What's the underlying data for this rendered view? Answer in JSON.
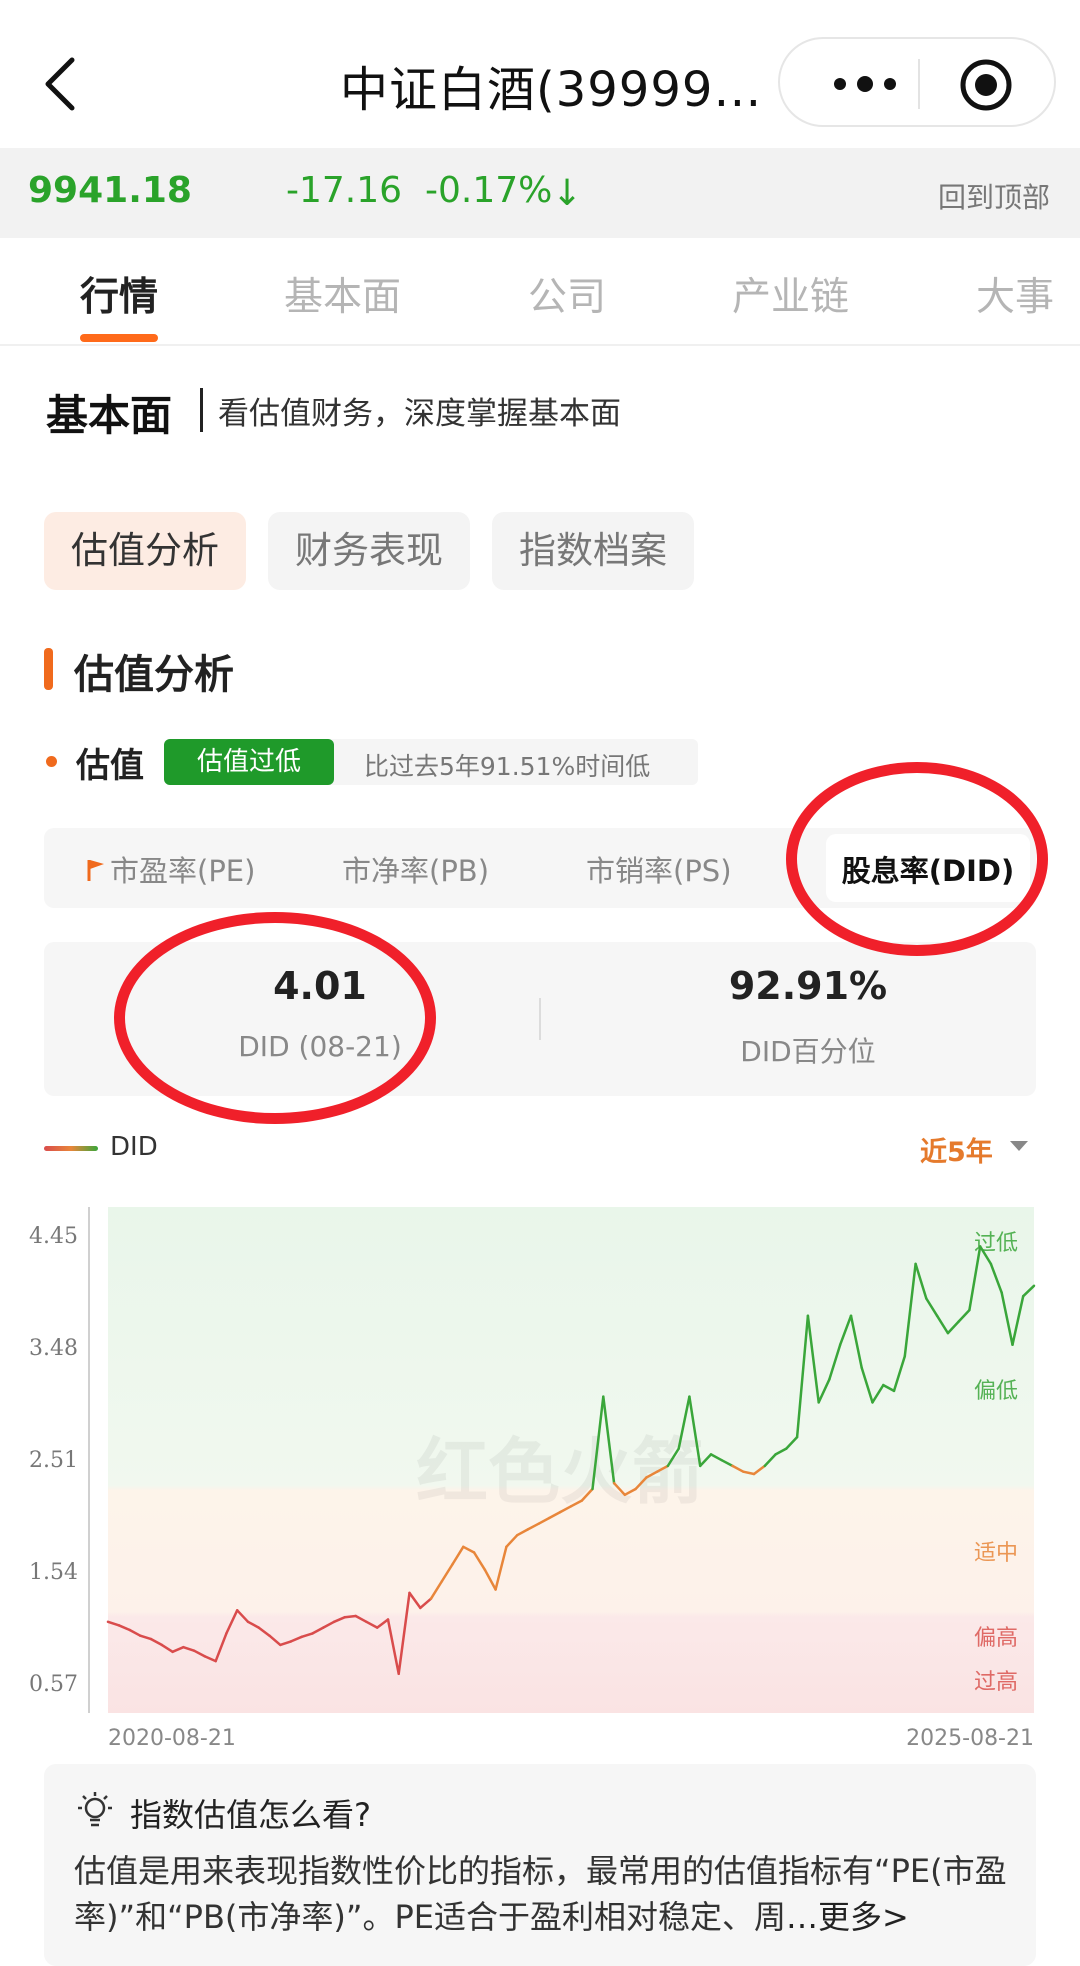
{
  "header": {
    "title": "中证白酒(39999…"
  },
  "quote": {
    "price": "9941.18",
    "change": "-17.16",
    "change_pct": "-0.17%",
    "arrow": "↓",
    "back_to_top": "回到顶部"
  },
  "tabs": [
    {
      "label": "行情",
      "active": true
    },
    {
      "label": "基本面",
      "active": false
    },
    {
      "label": "公司",
      "active": false
    },
    {
      "label": "产业链",
      "active": false
    },
    {
      "label": "大事",
      "active": false
    }
  ],
  "section": {
    "title": "基本面",
    "subtitle": "看估值财务，深度掌握基本面"
  },
  "chips": [
    "估值分析",
    "财务表现",
    "指数档案"
  ],
  "analysis": {
    "title": "估值分析",
    "valuation_label": "估值",
    "badge": "估值过低",
    "badge_note": "比过去5年91.51%时间低"
  },
  "metric_tabs": [
    "市盈率(PE)",
    "市净率(PB)",
    "市销率(PS)",
    "股息率(DID)"
  ],
  "values": {
    "current": "4.01",
    "current_label": "DID (08-21)",
    "percentile": "92.91%",
    "percentile_label": "DID百分位"
  },
  "legend": {
    "series": "DID",
    "range": "近5年"
  },
  "chart_data": {
    "type": "line",
    "ylim": [
      0.57,
      4.45
    ],
    "y_ticks": [
      "4.45",
      "3.48",
      "2.51",
      "1.54",
      "0.57"
    ],
    "x_labels": [
      "2020-08-21",
      "2025-08-21"
    ],
    "zone_labels": [
      "过低",
      "偏低",
      "适中",
      "偏高",
      "过高"
    ],
    "watermark": "红色火箭",
    "series": [
      {
        "name": "DID",
        "values": [
          1.1,
          1.07,
          1.03,
          0.98,
          0.95,
          0.9,
          0.84,
          0.88,
          0.85,
          0.8,
          0.76,
          1.0,
          1.2,
          1.1,
          1.05,
          0.98,
          0.9,
          0.93,
          0.97,
          1.0,
          1.05,
          1.1,
          1.14,
          1.15,
          1.1,
          1.05,
          1.12,
          0.65,
          1.35,
          1.22,
          1.3,
          1.45,
          1.6,
          1.75,
          1.7,
          1.55,
          1.38,
          1.75,
          1.85,
          1.9,
          1.95,
          2.0,
          2.05,
          2.1,
          2.15,
          2.25,
          3.05,
          2.3,
          2.2,
          2.25,
          2.35,
          2.4,
          2.45,
          2.6,
          3.05,
          2.45,
          2.55,
          2.5,
          2.45,
          2.4,
          2.38,
          2.45,
          2.55,
          2.6,
          2.7,
          3.75,
          3.0,
          3.2,
          3.5,
          3.75,
          3.3,
          3.0,
          3.15,
          3.1,
          3.4,
          4.2,
          3.9,
          3.75,
          3.6,
          3.7,
          3.8,
          4.35,
          4.2,
          3.95,
          3.5,
          3.92,
          4.01
        ]
      }
    ]
  },
  "tips": {
    "title": "指数估值怎么看?",
    "body": "估值是用来表现指数性价比的指标，最常用的估值指标有“PE(市盈率)”和“PB(市净率)”。PE适合于盈利相对稳定、周",
    "more": "…更多>"
  },
  "colors": {
    "accent": "#f06a1d",
    "up_green": "#2aa32a",
    "badge_green": "#1f9a2a",
    "annotation_red": "#f0202a"
  }
}
